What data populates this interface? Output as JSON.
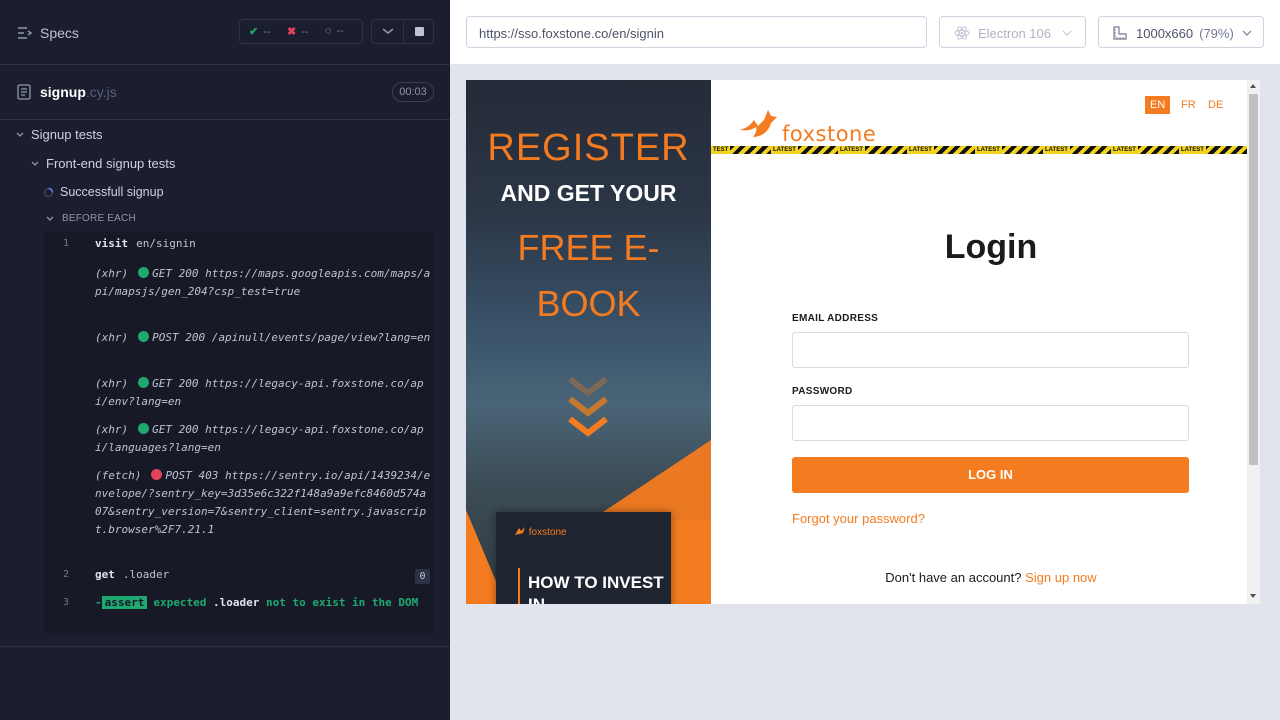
{
  "runner": {
    "specs_label": "Specs",
    "stats": {
      "passed": "--",
      "failed": "--",
      "pending": "--"
    },
    "spec_file": {
      "name": "signup",
      "ext": ".cy.js",
      "duration": "00:03"
    },
    "tree": {
      "suite": "Signup tests",
      "subsuite": "Front-end signup tests",
      "test": "Successfull signup",
      "hook": "BEFORE EACH"
    },
    "commands": [
      {
        "num": "1",
        "name": "visit",
        "arg": "en/signin"
      },
      {
        "num": "2",
        "name": "get",
        "arg": ".loader",
        "badge": "0"
      },
      {
        "num": "3"
      }
    ],
    "requests": [
      {
        "type": "(xhr)",
        "status": "success",
        "text": "GET 200 https://maps.googleapis.com/maps/api/mapsjs/gen_204?csp_test=true"
      },
      {
        "type": "(xhr)",
        "status": "success",
        "text": "POST 200 /apinull/events/page/view?lang=en"
      },
      {
        "type": "(xhr)",
        "status": "success",
        "text": "GET 200 https://legacy-api.foxstone.co/api/env?lang=en"
      },
      {
        "type": "(xhr)",
        "status": "success",
        "text": "GET 200 https://legacy-api.foxstone.co/api/languages?lang=en"
      },
      {
        "type": "(fetch)",
        "status": "error",
        "text": "POST 403 https://sentry.io/api/1439234/envelope/?sentry_key=3d35e6c322f148a9a9efc8460d574a07&sentry_version=7&sentry_client=sentry.javascript.browser%2F7.21.1"
      }
    ],
    "assertion": {
      "dash": "-",
      "tag": "assert",
      "expected": "expected",
      "selector": ".loader",
      "rest": "not to exist in the DOM"
    }
  },
  "topbar": {
    "url": "https://sso.foxstone.co/en/signin",
    "browser": "Electron 106",
    "viewport": "1000x660",
    "zoom": "(79%)"
  },
  "app": {
    "promo": {
      "line1": "REGISTER",
      "line2": "AND GET YOUR",
      "line3": "FREE E-BOOK",
      "book_logo": "foxstone",
      "book_title": "HOW TO INVEST IN"
    },
    "logo_text": "foxstone",
    "languages": [
      "EN",
      "FR",
      "DE"
    ],
    "tape_text": "LATEST",
    "tape_text_start": "TEST",
    "login_title": "Login",
    "email_label": "EMAIL ADDRESS",
    "password_label": "PASSWORD",
    "login_button": "LOG IN",
    "forgot_link": "Forgot your password?",
    "signup_prompt": "Don't have an account?",
    "signup_link": "Sign up now"
  },
  "colors": {
    "brand_orange": "#f47b20",
    "runner_bg": "#1b1e2e",
    "pass_green": "#1fa971",
    "fail_red": "#e0435a"
  }
}
